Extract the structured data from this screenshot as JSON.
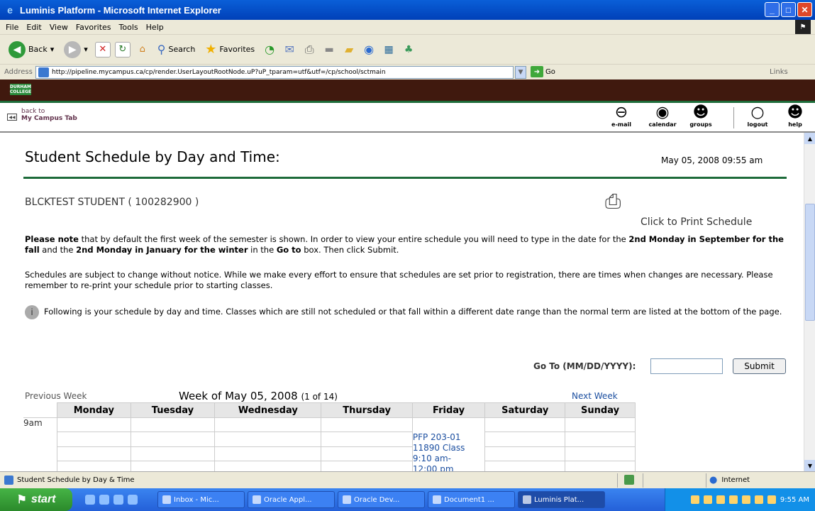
{
  "window": {
    "title": "Luminis Platform - Microsoft Internet Explorer"
  },
  "menu": [
    "File",
    "Edit",
    "View",
    "Favorites",
    "Tools",
    "Help"
  ],
  "toolbar": {
    "back": "Back",
    "search": "Search",
    "favorites": "Favorites"
  },
  "address": {
    "label": "Address",
    "url": "http://pipeline.mycampus.ca/cp/render.UserLayoutRootNode.uP?uP_tparam=utf&utf=/cp/school/sctmain",
    "go": "Go",
    "links": "Links"
  },
  "portal": {
    "logo": "DURHAM COLLEGE"
  },
  "nav": {
    "back_line1": "back to",
    "back_line2": "My Campus Tab",
    "items": [
      {
        "label": "e-mail",
        "icon": "mail-icon"
      },
      {
        "label": "calendar",
        "icon": "calendar-icon"
      },
      {
        "label": "groups",
        "icon": "groups-icon"
      },
      {
        "label": "logout",
        "icon": "logout-icon"
      },
      {
        "label": "help",
        "icon": "help-icon"
      }
    ]
  },
  "page": {
    "title": "Student Schedule by Day and Time:",
    "date": "May 05, 2008 09:55 am",
    "student": "BLCKTEST STUDENT ( 100282900 )",
    "print_label": "Click to Print Schedule",
    "note_bold1": "Please note",
    "note_text1": " that by default the first week of the semester is shown. In order to view your entire schedule you will need to type in the date for the ",
    "note_bold2": "2nd Monday in September for the fall",
    "note_text2": " and the ",
    "note_bold3": "2nd Monday in January for the winter",
    "note_text3": " in the ",
    "note_bold4": "Go to",
    "note_text4": " box. Then click Submit.",
    "change_note": "Schedules are subject to change without notice. While we make every effort to ensure that schedules are set prior to registration, there are times when changes are necessary. Please remember to re-print your schedule prior to starting classes.",
    "tip": "Following is your schedule by day and time. Classes which are still not scheduled or that fall within a different date range than the normal term are listed at the bottom of the page.",
    "goto_label": "Go To (MM/DD/YYYY):",
    "goto_value": "",
    "submit": "Submit",
    "prev_week": "Previous Week",
    "week_of": "Week of May 05, 2008",
    "week_count": "(1 of 14)",
    "next_week": "Next Week"
  },
  "schedule": {
    "days": [
      "Monday",
      "Tuesday",
      "Wednesday",
      "Thursday",
      "Friday",
      "Saturday",
      "Sunday"
    ],
    "time": "9am",
    "class_lines": [
      "PFP 203-01",
      "11890 Class",
      "9:10 am-",
      "12:00 pm"
    ]
  },
  "status": {
    "text": "Student Schedule by Day & Time",
    "zone": "Internet"
  },
  "taskbar": {
    "start": "start",
    "tasks": [
      "Inbox - Mic...",
      "Oracle Appl...",
      "Oracle Dev...",
      "Document1 ...",
      "Luminis Plat..."
    ],
    "clock": "9:55 AM"
  }
}
